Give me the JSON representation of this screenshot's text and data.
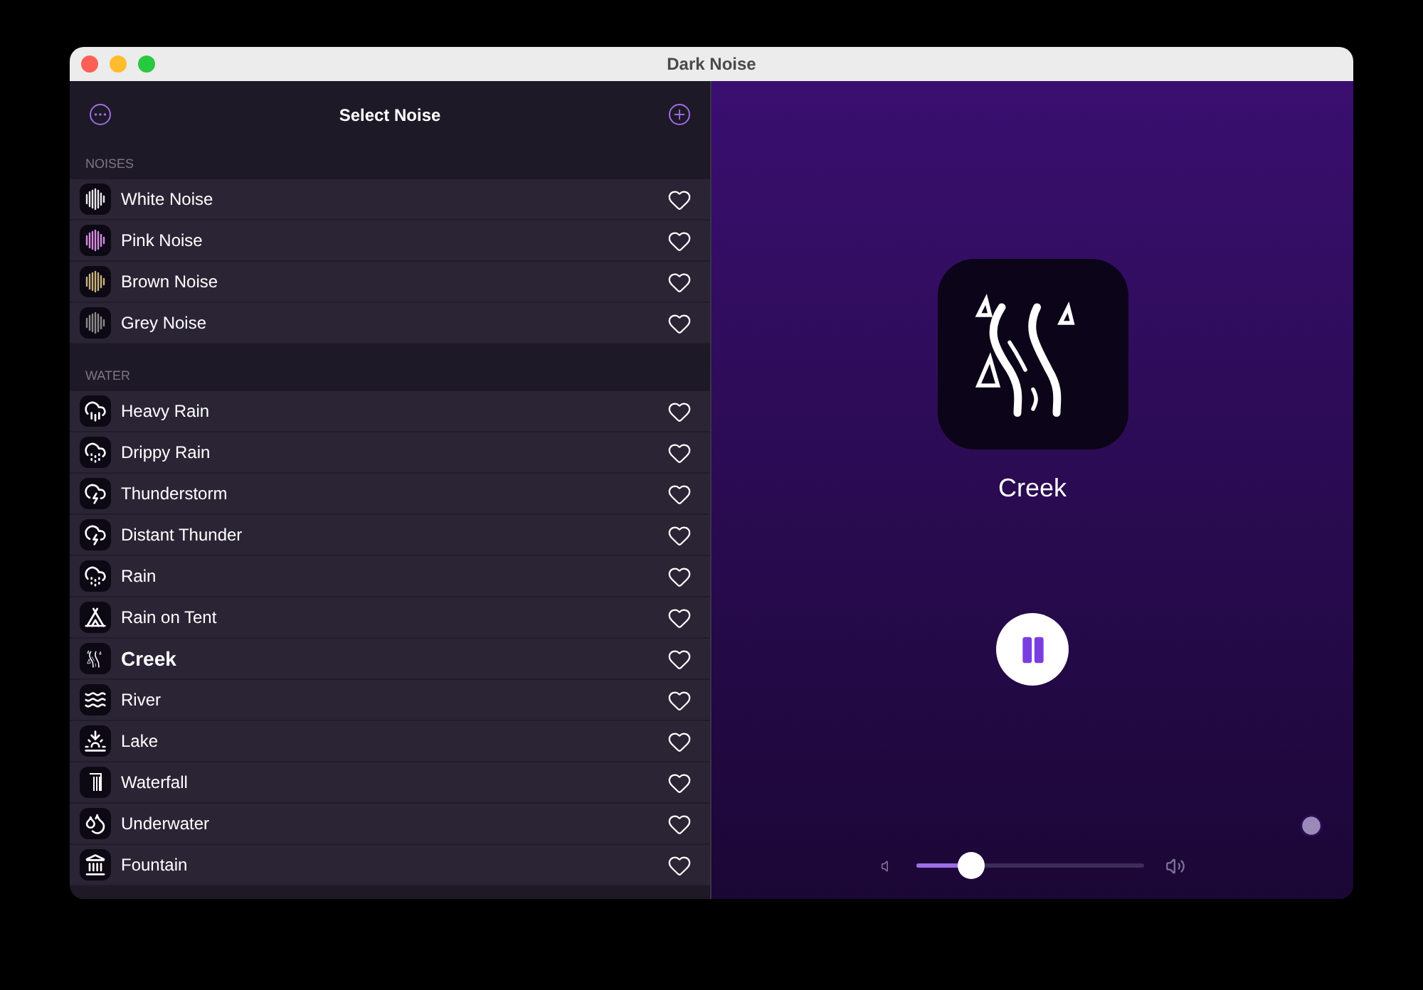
{
  "window": {
    "title": "Dark Noise"
  },
  "sidebar": {
    "title": "Select Noise",
    "sections": [
      {
        "title": "NOISES",
        "items": [
          {
            "label": "White Noise",
            "kind": "waveform",
            "color": "#e8e8e8",
            "selected": false,
            "favorite": false
          },
          {
            "label": "Pink Noise",
            "kind": "waveform",
            "color": "#d58be0",
            "selected": false,
            "favorite": false
          },
          {
            "label": "Brown Noise",
            "kind": "waveform",
            "color": "#c9b27c",
            "selected": false,
            "favorite": false
          },
          {
            "label": "Grey Noise",
            "kind": "waveform",
            "color": "#8a8a8a",
            "selected": false,
            "favorite": false
          }
        ]
      },
      {
        "title": "WATER",
        "items": [
          {
            "label": "Heavy Rain",
            "kind": "rain",
            "selected": false,
            "favorite": false
          },
          {
            "label": "Drippy Rain",
            "kind": "drizzle",
            "selected": false,
            "favorite": false
          },
          {
            "label": "Thunderstorm",
            "kind": "lightning",
            "selected": false,
            "favorite": false
          },
          {
            "label": "Distant Thunder",
            "kind": "lightning",
            "selected": false,
            "favorite": false
          },
          {
            "label": "Rain",
            "kind": "drizzle",
            "selected": false,
            "favorite": false
          },
          {
            "label": "Rain on Tent",
            "kind": "tent",
            "selected": false,
            "favorite": false
          },
          {
            "label": "Creek",
            "kind": "creek",
            "selected": true,
            "favorite": false
          },
          {
            "label": "River",
            "kind": "waves",
            "selected": false,
            "favorite": false
          },
          {
            "label": "Lake",
            "kind": "lake",
            "selected": false,
            "favorite": false
          },
          {
            "label": "Waterfall",
            "kind": "waterfall",
            "selected": false,
            "favorite": false
          },
          {
            "label": "Underwater",
            "kind": "bubbles",
            "selected": false,
            "favorite": false
          },
          {
            "label": "Fountain",
            "kind": "fountain",
            "selected": false,
            "favorite": false
          }
        ]
      }
    ]
  },
  "player": {
    "title": "Creek",
    "playing": true,
    "volume": {
      "level": 0.24
    }
  }
}
